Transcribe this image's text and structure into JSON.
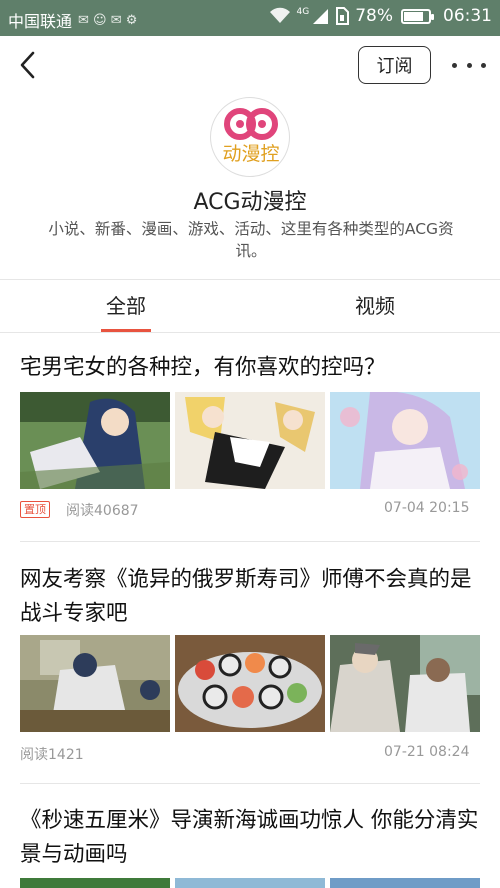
{
  "status_bar": {
    "carrier": "中国联通",
    "network": "4G",
    "battery": "78%",
    "battery_level": 0.78,
    "time": "06:31"
  },
  "nav": {
    "subscribe_label": "订阅"
  },
  "channel": {
    "logo_text": "动漫控",
    "name": "ACG动漫控",
    "description": "小说、新番、漫画、游戏、活动、这里有各种类型的ACG资讯。"
  },
  "tabs": [
    {
      "label": "全部",
      "active": true
    },
    {
      "label": "视频",
      "active": false
    }
  ],
  "articles": [
    {
      "title": "宅男宅女的各种控，有你喜欢的控吗？",
      "pin": "置顶",
      "reads": "阅读40687",
      "date": "07-04 20:15"
    },
    {
      "title": "网友考察《诡异的俄罗斯寿司》师傅不会真的是战斗专家吧",
      "reads": "阅读1421",
      "date": "07-21 08:24"
    },
    {
      "title": "《秒速五厘米》导演新海诚画功惊人 你能分清实景与动画吗"
    }
  ],
  "colors": {
    "accent": "#e8533f",
    "status_bar": "#5f7f6a"
  }
}
